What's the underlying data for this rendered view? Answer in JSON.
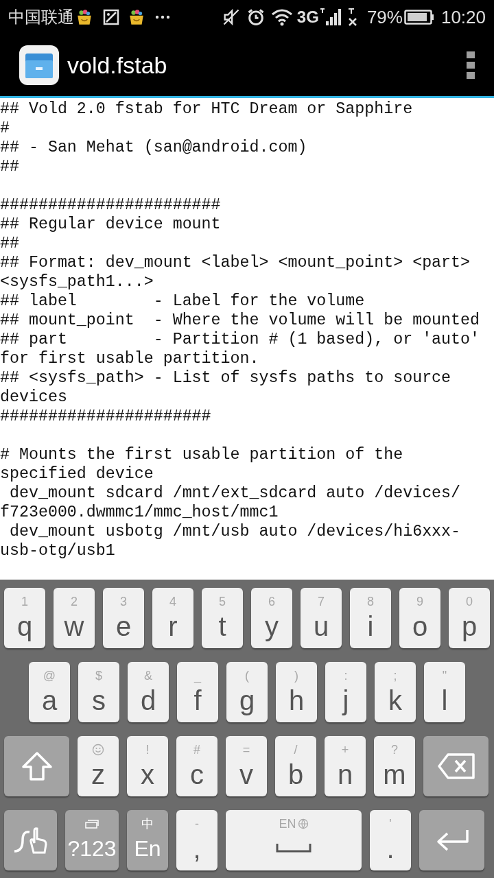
{
  "status_bar": {
    "carrier": "中国联通",
    "network": "3G",
    "battery": "79%",
    "time": "10:20"
  },
  "action_bar": {
    "title": "vold.fstab"
  },
  "document": {
    "blocks": [
      {
        "lines": [
          "## Vold 2.0 fstab for HTC Dream or Sapphire",
          "#",
          "## - San Mehat (san@android.com)",
          "##"
        ]
      },
      {
        "lines": [
          "#######################",
          "## Regular device mount",
          "##",
          "## Format: dev_mount <label> <mount_point> <part>",
          "<sysfs_path1...>",
          "## label        - Label for the volume",
          "## mount_point  - Where the volume will be mounted",
          "## part         - Partition # (1 based), or 'auto'",
          "for first usable partition.",
          "## <sysfs_path> - List of sysfs paths to source",
          "devices",
          "######################"
        ]
      },
      {
        "lines": [
          "# Mounts the first usable partition of the",
          "specified device",
          " dev_mount sdcard /mnt/ext_sdcard auto /devices/",
          "f723e000.dwmmc1/mmc_host/mmc1",
          " dev_mount usbotg /mnt/usb auto /devices/hi6xxx-",
          "usb-otg/usb1"
        ]
      }
    ]
  },
  "keyboard": {
    "rows": [
      {
        "keys": [
          {
            "kind": "char",
            "hint": "1",
            "label": "q"
          },
          {
            "kind": "char",
            "hint": "2",
            "label": "w"
          },
          {
            "kind": "char",
            "hint": "3",
            "label": "e"
          },
          {
            "kind": "char",
            "hint": "4",
            "label": "r"
          },
          {
            "kind": "char",
            "hint": "5",
            "label": "t"
          },
          {
            "kind": "char",
            "hint": "6",
            "label": "y"
          },
          {
            "kind": "char",
            "hint": "7",
            "label": "u"
          },
          {
            "kind": "char",
            "hint": "8",
            "label": "i"
          },
          {
            "kind": "char",
            "hint": "9",
            "label": "o"
          },
          {
            "kind": "char",
            "hint": "0",
            "label": "p"
          }
        ]
      },
      {
        "keys": [
          {
            "kind": "char",
            "hint": "@",
            "label": "a"
          },
          {
            "kind": "char",
            "hint": "$",
            "label": "s"
          },
          {
            "kind": "char",
            "hint": "&",
            "label": "d"
          },
          {
            "kind": "char",
            "hint": "_",
            "label": "f"
          },
          {
            "kind": "char",
            "hint": "(",
            "label": "g"
          },
          {
            "kind": "char",
            "hint": ")",
            "label": "h"
          },
          {
            "kind": "char",
            "hint": ":",
            "label": "j"
          },
          {
            "kind": "char",
            "hint": ";",
            "label": "k"
          },
          {
            "kind": "char",
            "hint": "\"",
            "label": "l"
          }
        ]
      },
      {
        "keys": [
          {
            "kind": "shift"
          },
          {
            "kind": "emoji",
            "label": "z"
          },
          {
            "kind": "char",
            "hint": "!",
            "label": "x"
          },
          {
            "kind": "char",
            "hint": "#",
            "label": "c"
          },
          {
            "kind": "char",
            "hint": "=",
            "label": "v"
          },
          {
            "kind": "char",
            "hint": "/",
            "label": "b"
          },
          {
            "kind": "char",
            "hint": "+",
            "label": "n"
          },
          {
            "kind": "char",
            "hint": "?",
            "label": "m"
          },
          {
            "kind": "delete"
          }
        ]
      },
      {
        "keys": [
          {
            "kind": "gesture"
          },
          {
            "kind": "symbols",
            "label": "?123"
          },
          {
            "kind": "language",
            "hint": "中",
            "label": "En"
          },
          {
            "kind": "char",
            "hint": "-",
            "label": ","
          },
          {
            "kind": "space",
            "hint": "EN"
          },
          {
            "kind": "char",
            "hint": "'",
            "label": "."
          },
          {
            "kind": "enter"
          }
        ]
      }
    ]
  }
}
